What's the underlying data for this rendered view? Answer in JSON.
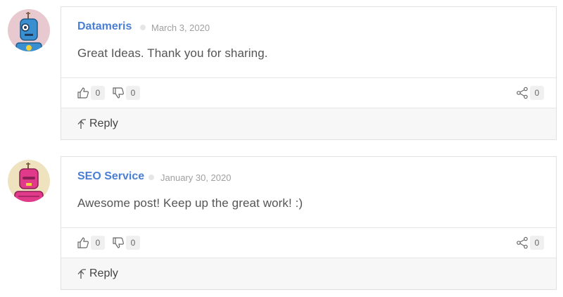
{
  "comments": [
    {
      "author": "Datameris",
      "date": "March 3, 2020",
      "text": "Great Ideas. Thank you for sharing.",
      "likes": "0",
      "dislikes": "0",
      "shares": "0",
      "reply_label": "Reply",
      "avatar_bg": "#e7c9cf",
      "robot_color": "#3a8fd0"
    },
    {
      "author": "SEO Service",
      "date": "January 30, 2020",
      "text": "Awesome post! Keep up the great work! :)",
      "likes": "0",
      "dislikes": "0",
      "shares": "0",
      "reply_label": "Reply",
      "avatar_bg": "#efe3bf",
      "robot_color": "#e23a8a"
    }
  ],
  "icons": {
    "like": "thumbs-up-icon",
    "dislike": "thumbs-down-icon",
    "share": "share-icon",
    "reply": "reply-arrow-icon"
  }
}
